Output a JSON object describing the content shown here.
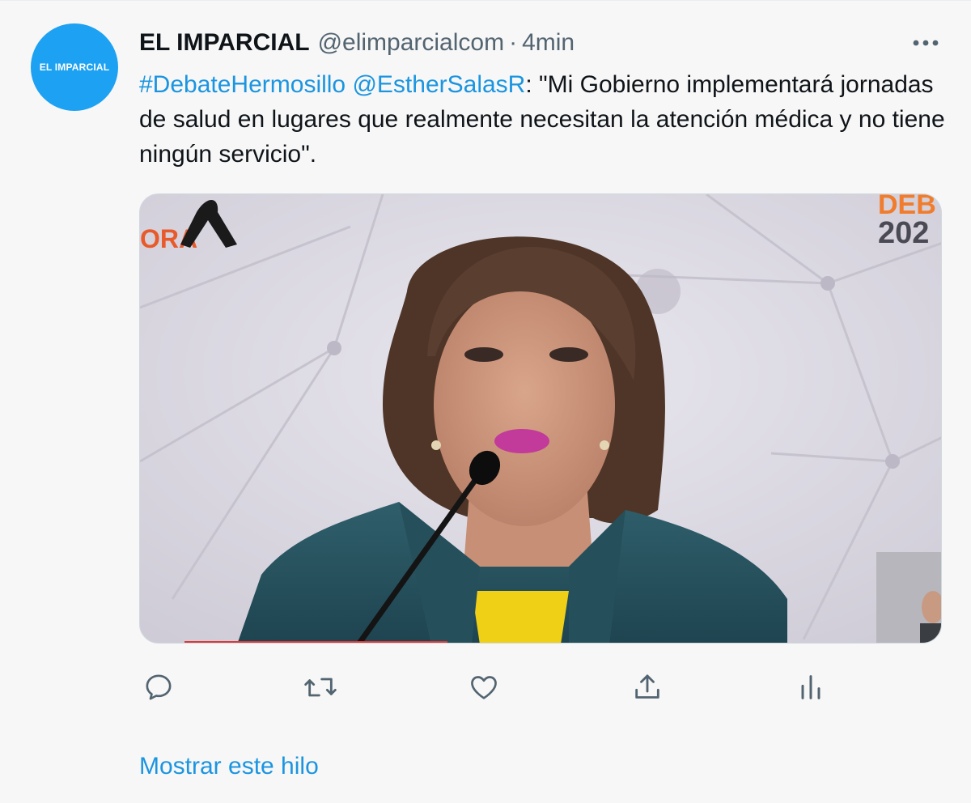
{
  "tweet": {
    "avatar_label": "EL IMPARCIAL",
    "author_name": "EL IMPARCIAL",
    "author_handle": "@elimparcialcom",
    "separator": "·",
    "timestamp": "4min",
    "text": {
      "hashtag": "#DebateHermosillo",
      "mention": "@EstherSalasR",
      "body": ": \"Mi Gobierno implementará jornadas de salud en lugares que realmente necesitan la atención médica y no tiene ningún servicio\"."
    },
    "media": {
      "overlay_left": "ORA",
      "overlay_right_top": "DEB",
      "overlay_right_bottom": "202"
    },
    "actions": {
      "reply_icon": "reply-icon",
      "retweet_icon": "retweet-icon",
      "like_icon": "heart-icon",
      "share_icon": "share-icon",
      "analytics_icon": "analytics-icon"
    },
    "show_thread": "Mostrar este hilo"
  },
  "colors": {
    "link": "#1b95e0",
    "avatar_bg": "#1da1f2",
    "icon": "#536471"
  }
}
